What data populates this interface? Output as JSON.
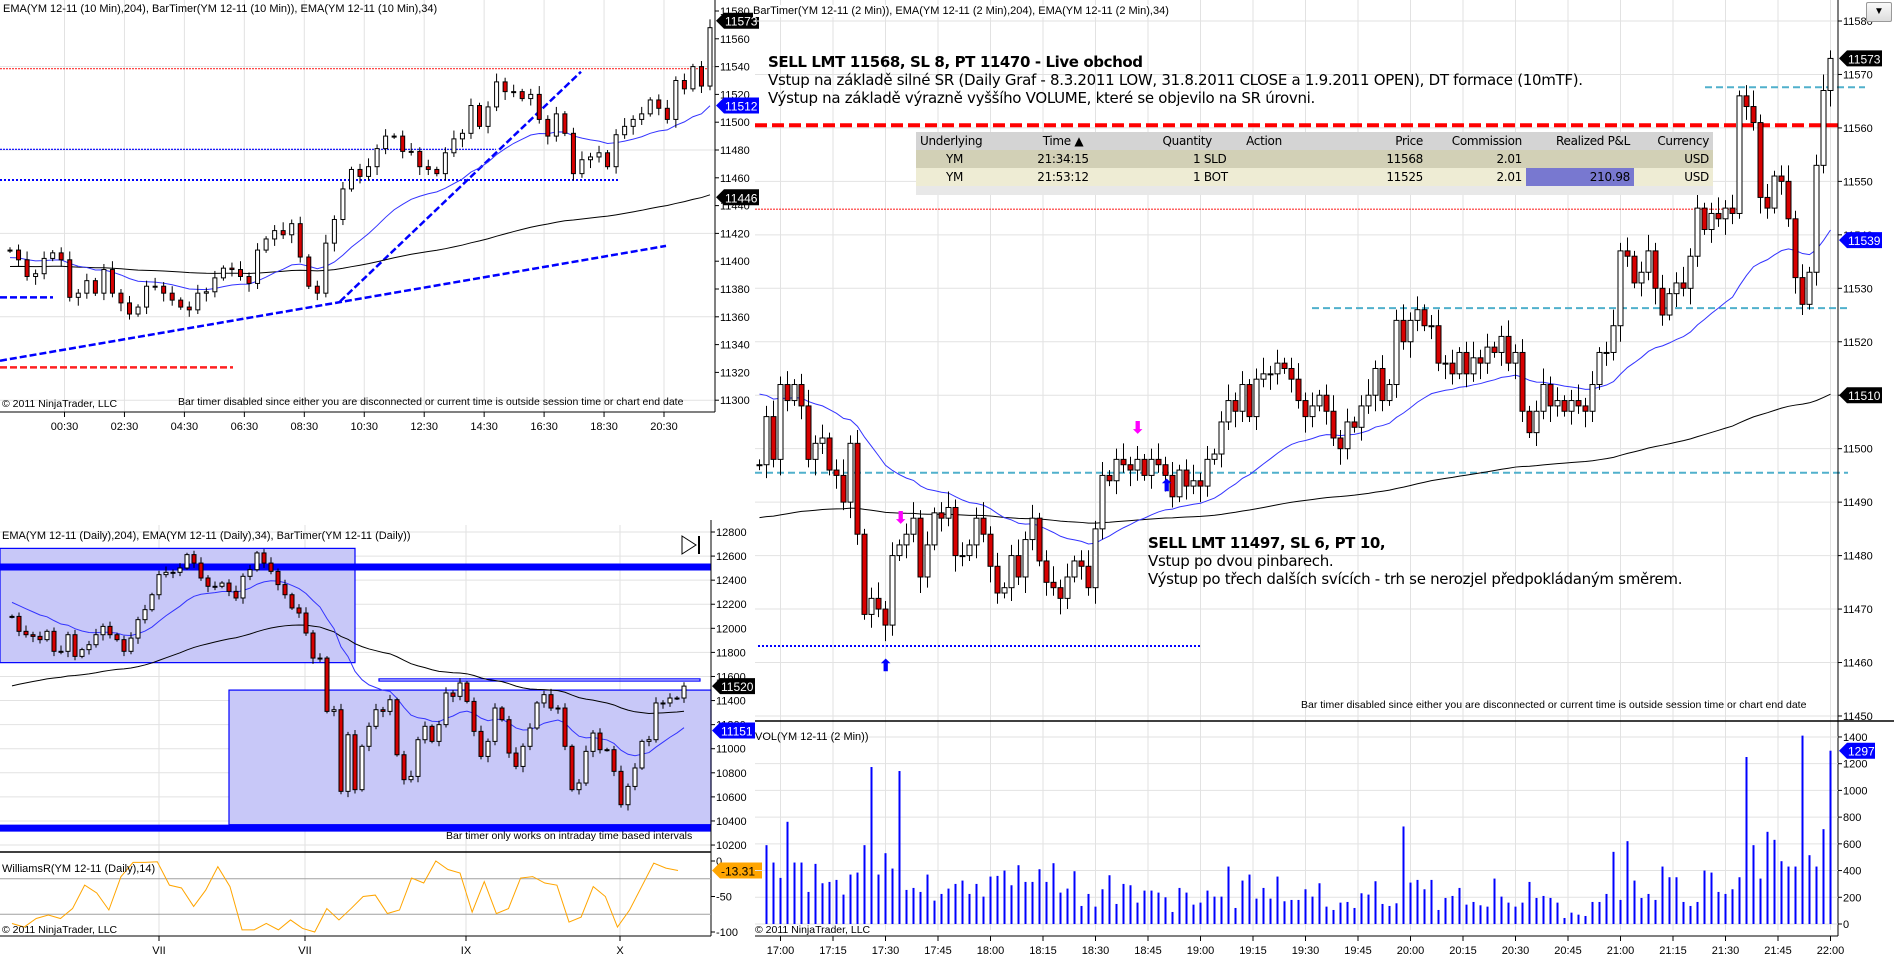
{
  "ui": {
    "menu_button_icon": "▼"
  },
  "annotations": {
    "trade1": {
      "title": "SELL LMT 11568, SL 8, PT 11470 - Live obchod",
      "line1": "Vstup na základě silné SR (Daily Graf - 8.3.2011 LOW, 31.8.2011 CLOSE a 1.9.2011 OPEN), DT formace (10mTF).",
      "line2": "Výstup na základě výrazně vyššího VOLUME, které se objevilo na SR úrovni."
    },
    "trade2": {
      "title": "SELL LMT 11497, SL 6, PT 10,",
      "line1": "Vstup po dvou pinbarech.",
      "line2": "Výstup po třech dalších svících - trh se nerozjel předpokládaným směrem."
    },
    "signals": [
      {
        "type": "sell-signal",
        "glyph": "⬇",
        "color": "#ff00ff"
      },
      {
        "type": "sell-signal",
        "glyph": "⬇",
        "color": "#ff00ff"
      },
      {
        "type": "buy-signal",
        "glyph": "⬆",
        "color": "#0000ff"
      },
      {
        "type": "buy-signal",
        "glyph": "⬆",
        "color": "#0000ff"
      }
    ]
  },
  "trades_table": {
    "headers": [
      "Underlying",
      "Time ▲",
      "Quantity",
      "Action",
      "Price",
      "Commission",
      "Realized P&L",
      "Currency"
    ],
    "rows": [
      [
        "YM",
        "21:34:15",
        "1 SLD",
        "",
        "11568",
        "2.01",
        "",
        "USD"
      ],
      [
        "YM",
        "21:53:12",
        "1 BOT",
        "",
        "11525",
        "2.01",
        "210.98",
        "USD"
      ]
    ]
  },
  "colors": {
    "up": "#ffffff",
    "down": "#d80000",
    "ema_fast": "#3333ff",
    "ema_slow": "#000000",
    "volume": "#0000ff",
    "williams": "#ffa500",
    "rect_fill": "#c8c8f8",
    "rect_stroke": "#0000ff"
  },
  "chart_data": [
    {
      "id": "tenmin",
      "type": "candlestick",
      "title": "EMA(YM 12-11 (10 Min),204), BarTimer(YM 12-11 (10 Min)), EMA(YM 12-11 (10 Min),34)",
      "note": "Bar timer disabled since either you are disconnected or current time is outside session time or chart end date",
      "copyright": "© 2011 NinjaTrader, LLC",
      "ylim": [
        11300,
        11580
      ],
      "y_ticks": [
        11580,
        11560,
        11540,
        11520,
        11500,
        11480,
        11460,
        11440,
        11420,
        11400,
        11380,
        11360,
        11340,
        11320,
        11300
      ],
      "x_ticks": [
        "00:30",
        "02:30",
        "04:30",
        "06:30",
        "08:30",
        "10:30",
        "12:30",
        "14:30",
        "16:30",
        "18:30",
        "20:30"
      ],
      "closes": [
        11408,
        11401,
        11389,
        11391,
        11402,
        11406,
        11401,
        11374,
        11377,
        11386,
        11377,
        11394,
        11377,
        11370,
        11362,
        11367,
        11382,
        11382,
        11377,
        11372,
        11367,
        11365,
        11377,
        11378,
        11388,
        11395,
        11394,
        11389,
        11384,
        11408,
        11416,
        11422,
        11419,
        11427,
        11403,
        11382,
        11377,
        11413,
        11430,
        11452,
        11466,
        11461,
        11468,
        11481,
        11490,
        11490,
        11479,
        11479,
        11468,
        11466,
        11463,
        11478,
        11488,
        11492,
        11512,
        11497,
        11511,
        11529,
        11522,
        11522,
        11517,
        11520,
        11502,
        11490,
        11506,
        11492,
        11463,
        11473,
        11475,
        11478,
        11468,
        11491,
        11497,
        11502,
        11506,
        11516,
        11510,
        11502,
        11530,
        11524,
        11540,
        11526,
        11568
      ],
      "ema_seeds": {
        "fast": 11402,
        "slow": 11396
      },
      "ema_periods": {
        "fast": 34,
        "slow": 204
      },
      "tags": [
        {
          "value": "11573",
          "price": 11573,
          "color": "#000000"
        },
        {
          "value": "11512",
          "price": 11512,
          "color": "#0000ff"
        },
        {
          "value": "11446",
          "price": 11446,
          "color": "#000000"
        }
      ],
      "levels": [
        {
          "price": 11538.5,
          "style": "red-dotted"
        },
        {
          "price": 11480.5,
          "style": "blue-dotted-thin"
        },
        {
          "price": 11458.4,
          "style": "blue-dotted-thick"
        },
        {
          "price": 11374,
          "style": "blue-dashed"
        },
        {
          "price": 11323.6,
          "style": "red-dashed"
        }
      ],
      "trendlines": [
        {
          "from": 11328.4,
          "to": 11411,
          "style": "blue-dashed"
        },
        {
          "from": 11371,
          "to": 11536.3,
          "style": "blue-dashed"
        }
      ]
    },
    {
      "id": "daily",
      "type": "candlestick",
      "title": "EMA(YM 12-11 (Daily),204), EMA(YM 12-11 (Daily),34), BarTimer(YM 12-11 (Daily))",
      "note": "Bar timer only works on intraday time based intervals",
      "ylim": [
        10200,
        12800
      ],
      "y_ticks": [
        12800,
        12600,
        12400,
        12200,
        12000,
        11800,
        11600,
        11400,
        11200,
        11000,
        10800,
        10600,
        10400,
        10200
      ],
      "x_ticks": [
        "VII",
        "VII",
        "IX",
        "X"
      ],
      "closes": [
        12099,
        11975,
        11947,
        11933,
        11906,
        11975,
        11809,
        11809,
        11947,
        11767,
        11823,
        11864,
        11947,
        12016,
        11947,
        11906,
        11809,
        11919,
        12072,
        12155,
        12279,
        12446,
        12465,
        12465,
        12501,
        12612,
        12542,
        12418,
        12349,
        12349,
        12376,
        12307,
        12252,
        12432,
        12487,
        12626,
        12542,
        12473,
        12363,
        12279,
        12169,
        12127,
        11961,
        11753,
        11753,
        11310,
        11324,
        10646,
        11116,
        10660,
        11020,
        11186,
        11324,
        11310,
        11407,
        10950,
        10743,
        10770,
        11075,
        11186,
        11061,
        11200,
        11463,
        11435,
        11546,
        11393,
        11144,
        10936,
        11061,
        11338,
        11241,
        10964,
        10853,
        11020,
        11172,
        11380,
        11449,
        11338,
        11338,
        11020,
        10660,
        10715,
        10978,
        11130,
        10992,
        10992,
        10812,
        10535,
        10687,
        10840,
        11061,
        11075,
        11380,
        11380,
        11421,
        11421,
        11520
      ],
      "ema_seeds": {
        "fast": 12230,
        "slow": 11505
      },
      "ema_periods": {
        "fast": 34,
        "slow": 204
      },
      "tags": [
        {
          "value": "11520",
          "price": 11520,
          "color": "#000000"
        },
        {
          "value": "11151",
          "price": 11151,
          "color": "#0000ff"
        }
      ],
      "levels": [
        {
          "price": 12509,
          "style": "blue-thick"
        },
        {
          "price": 10341,
          "style": "blue-thick"
        }
      ],
      "zones": [
        {
          "top": 12664,
          "bottom": 11715
        },
        {
          "top": 11487,
          "bottom": 10369
        },
        {
          "top": 11580,
          "bottom": 11562
        }
      ]
    },
    {
      "id": "williams",
      "type": "line",
      "title": "WilliamsR(YM 12-11 (Daily),14)",
      "copyright": "© 2011 NinjaTrader, LLC",
      "ylim": [
        -100,
        0
      ],
      "y_ticks": [
        0,
        -50,
        -100
      ],
      "levels": [
        -25,
        -75
      ],
      "values": [
        -88,
        -93,
        -81,
        -76,
        -81,
        -67,
        -34,
        -45,
        -69,
        -22,
        -2,
        -2,
        -1,
        -34,
        -38,
        -64,
        -41,
        -8,
        -36,
        -97,
        -97,
        -88,
        -97,
        -83,
        -95,
        -100,
        -67,
        -83,
        -67,
        -50,
        -48,
        -74,
        -69,
        -24,
        -31,
        0,
        -12,
        -17,
        -72,
        -29,
        -74,
        -67,
        -24,
        -22,
        -31,
        -34,
        -86,
        -79,
        -36,
        -50,
        -93,
        -69,
        -36,
        -3,
        -10,
        -13.31
      ],
      "tag": {
        "value": "-13.31",
        "color": "#ffa500"
      }
    },
    {
      "id": "twomin",
      "type": "candlestick",
      "title": "BarTimer(YM 12-11 (2 Min)), EMA(YM 12-11 (2 Min),204), EMA(YM 12-11 (2 Min),34)",
      "note": "Bar timer disabled since either you are disconnected or current time is outside session time or chart end date",
      "ylim": [
        11450,
        11580
      ],
      "y_ticks": [
        11580,
        11570,
        11560,
        11550,
        11540,
        11530,
        11520,
        11510,
        11500,
        11490,
        11480,
        11470,
        11460,
        11450
      ],
      "x_ticks": [
        "17:00",
        "17:15",
        "17:30",
        "17:45",
        "18:00",
        "18:15",
        "18:30",
        "18:45",
        "19:00",
        "19:15",
        "19:30",
        "19:45",
        "20:00",
        "20:15",
        "20:30",
        "20:45",
        "21:00",
        "21:15",
        "21:30",
        "21:45",
        "22:00"
      ],
      "closes": [
        11497,
        11506,
        11498,
        11512,
        11509,
        11512,
        11508,
        11498,
        11501,
        11502,
        11496,
        11495,
        11490,
        11501,
        11484,
        11469,
        11472,
        11470,
        11467,
        11480,
        11482,
        11484,
        11487,
        11476,
        11482,
        11488,
        11487,
        11489,
        11480,
        11480,
        11482,
        11487,
        11484,
        11478,
        11473,
        11474,
        11480,
        11476,
        11483,
        11487,
        11479,
        11475,
        11474,
        11472,
        11476,
        11479,
        11478,
        11474,
        11485,
        11495,
        11494,
        11498,
        11497,
        11496,
        11498,
        11495,
        11498,
        11497,
        11495,
        11491,
        11496,
        11493,
        11494,
        11493,
        11498,
        11499,
        11505,
        11509,
        11507,
        11512,
        11506,
        11513,
        11514,
        11514,
        11516,
        11515,
        11513,
        11509,
        11506,
        11508,
        11510,
        11507,
        11502,
        11500,
        11505,
        11504,
        11508,
        11510,
        11515,
        11509,
        11512,
        11524,
        11520,
        11524,
        11526,
        11523,
        11523,
        11516,
        11516,
        11514,
        11518,
        11514,
        11517,
        11516,
        11519,
        11518,
        11521,
        11516,
        11518,
        11507,
        11503,
        11507,
        11512,
        11508,
        11509,
        11507,
        11509,
        11508,
        11507,
        11512,
        11518,
        11518,
        11523,
        11537,
        11536,
        11531,
        11533,
        11537,
        11530,
        11525,
        11529,
        11531,
        11530,
        11536,
        11545,
        11541,
        11544,
        11543,
        11545,
        11544,
        11566,
        11564,
        11561,
        11547,
        11545,
        11551,
        11550,
        11543,
        11532,
        11527,
        11533,
        11553,
        11567,
        11573
      ],
      "ema_seeds": {
        "fast": 11511,
        "slow": 11487
      },
      "ema_periods": {
        "fast": 34,
        "slow": 204
      },
      "tags": [
        {
          "value": "11573",
          "price": 11573,
          "color": "#000000"
        },
        {
          "value": "11539",
          "price": 11539,
          "color": "#0000ff"
        },
        {
          "value": "11510",
          "price": 11510,
          "color": "#000000"
        }
      ],
      "levels": [
        {
          "price": 11560.5,
          "style": "red-dashed-thick"
        },
        {
          "price": 11544.8,
          "style": "red-dotted"
        },
        {
          "price": 11567.6,
          "style": "cyan-dashed"
        },
        {
          "price": 11526.3,
          "style": "cyan-dashed"
        },
        {
          "price": 11495.5,
          "style": "cyan-dashed"
        },
        {
          "price": 11463.1,
          "style": "blue-dotted-thick"
        }
      ]
    },
    {
      "id": "volume",
      "type": "bar",
      "title": "VOL(YM 12-11 (2 Min))",
      "copyright": "© 2011 NinjaTrader, LLC",
      "ylim": [
        0,
        1400
      ],
      "y_ticks": [
        1400,
        1200,
        1000,
        800,
        600,
        400,
        200,
        0
      ],
      "values": [
        590,
        460,
        345,
        765,
        460,
        460,
        240,
        450,
        305,
        315,
        330,
        220,
        370,
        385,
        590,
        1175,
        370,
        530,
        415,
        1145,
        255,
        270,
        240,
        370,
        175,
        225,
        265,
        300,
        325,
        225,
        300,
        205,
        355,
        360,
        400,
        290,
        440,
        315,
        315,
        410,
        315,
        455,
        235,
        265,
        395,
        135,
        225,
        130,
        260,
        365,
        150,
        300,
        290,
        160,
        250,
        250,
        235,
        200,
        90,
        270,
        235,
        145,
        160,
        250,
        205,
        205,
        430,
        120,
        325,
        370,
        190,
        270,
        190,
        355,
        170,
        180,
        180,
        260,
        205,
        305,
        130,
        105,
        160,
        165,
        120,
        230,
        220,
        320,
        150,
        135,
        155,
        730,
        310,
        330,
        260,
        330,
        105,
        195,
        210,
        270,
        145,
        165,
        140,
        130,
        340,
        205,
        160,
        130,
        160,
        315,
        195,
        210,
        195,
        160,
        45,
        85,
        70,
        60,
        165,
        165,
        225,
        540,
        180,
        620,
        325,
        195,
        225,
        180,
        430,
        350,
        350,
        165,
        135,
        165,
        400,
        385,
        240,
        225,
        260,
        350,
        1250,
        590,
        340,
        690,
        630,
        470,
        430,
        430,
        1410,
        515,
        430,
        710,
        1297
      ],
      "tag": {
        "value": "1297",
        "color": "#0000ff"
      }
    }
  ]
}
